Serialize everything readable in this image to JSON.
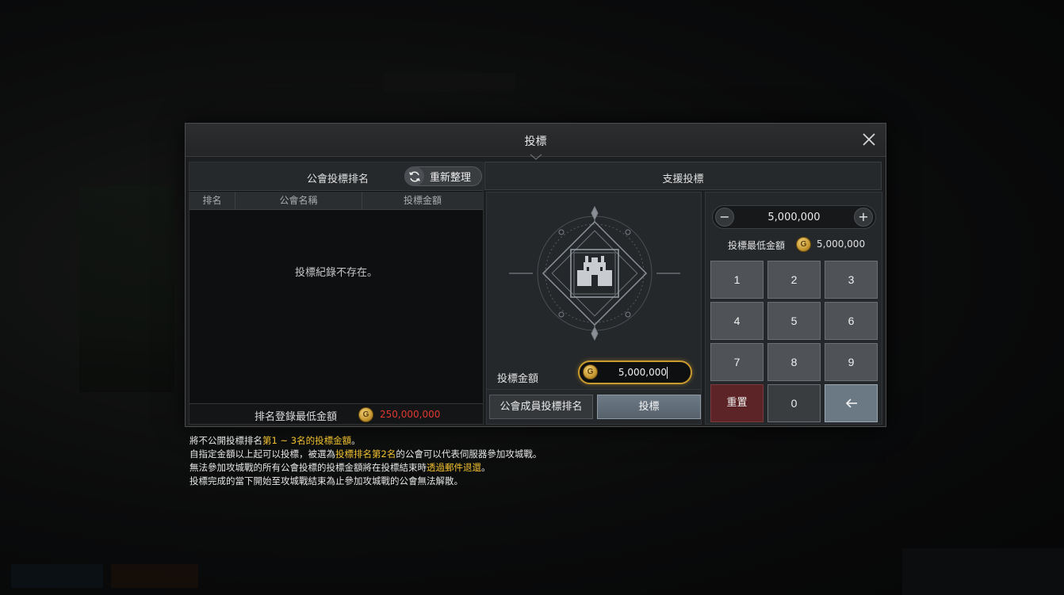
{
  "dialog": {
    "title": "投標"
  },
  "ranking": {
    "title": "公會投標排名",
    "refresh_label": "重新整理",
    "columns": [
      "排名",
      "公會名稱",
      "投標金額"
    ],
    "empty_message": "投標紀錄不存在。",
    "min_label": "排名登錄最低金額",
    "min_value": "250,000,000"
  },
  "support": {
    "title": "支援投標",
    "bid_label": "投標金額",
    "bid_value": "5,000,000",
    "member_rank_button": "公會成員投標排名",
    "bid_button": "投標"
  },
  "keypad": {
    "stepper_value": "5,000,000",
    "minus": "−",
    "plus": "+",
    "min_label": "投標最低金額",
    "min_value": "5,000,000",
    "keys": [
      "1",
      "2",
      "3",
      "4",
      "5",
      "6",
      "7",
      "8",
      "9",
      "重置",
      "0"
    ],
    "coin_letter": "G"
  },
  "notes": {
    "line1_a": "將不公開投標排名",
    "line1_b": "第1 ~ 3名的投標金額",
    "line1_c": "。",
    "line2_a": "自指定金額以上起可以投標，被選為",
    "line2_b": "投標排名第2名",
    "line2_c": "的公會可以代表伺服器參加攻城戰。",
    "line3_a": "無法參加攻城戰的所有公會投標的投標金額將在投標結束時",
    "line3_b": "透過郵件退還",
    "line3_c": "。",
    "line4": "投標完成的當下開始至攻城戰結束為止參加攻城戰的公會無法解散。"
  },
  "colors": {
    "highlight": "#f2c230",
    "min_amount_red": "#e0392f",
    "input_border_gold": "#c99a2e",
    "reset_key": "#5c2426"
  }
}
